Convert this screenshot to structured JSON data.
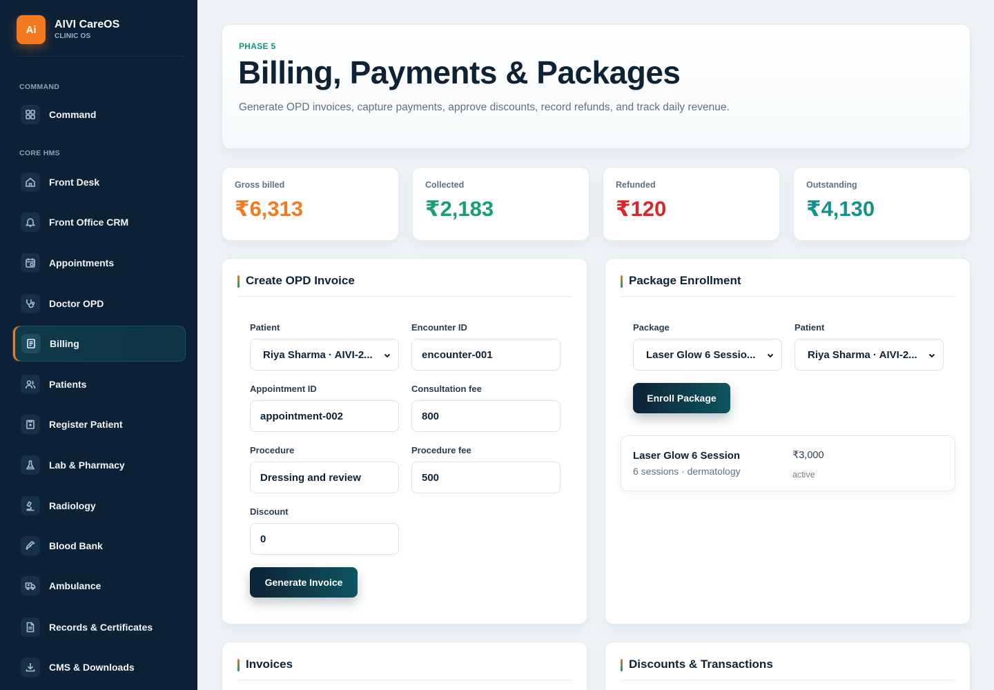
{
  "brand": {
    "logo": "Ai",
    "name": "AIVI CareOS",
    "sub": "CLINIC OS"
  },
  "sidebar": {
    "sections": [
      {
        "label": "COMMAND"
      },
      {
        "label": "CORE HMS"
      }
    ],
    "items": [
      {
        "label": "Command",
        "icon": "grid-icon"
      },
      {
        "label": "Front Desk",
        "icon": "home-icon"
      },
      {
        "label": "Front Office CRM",
        "icon": "bell-icon"
      },
      {
        "label": "Appointments",
        "icon": "calendar-icon"
      },
      {
        "label": "Doctor OPD",
        "icon": "stethoscope-icon"
      },
      {
        "label": "Billing",
        "icon": "receipt-icon",
        "active": true
      },
      {
        "label": "Patients",
        "icon": "users-icon"
      },
      {
        "label": "Register Patient",
        "icon": "clipboard-icon"
      },
      {
        "label": "Lab & Pharmacy",
        "icon": "flask-icon"
      },
      {
        "label": "Radiology",
        "icon": "microscope-icon"
      },
      {
        "label": "Blood Bank",
        "icon": "syringe-icon"
      },
      {
        "label": "Ambulance",
        "icon": "ambulance-icon"
      },
      {
        "label": "Records & Certificates",
        "icon": "document-icon"
      },
      {
        "label": "CMS & Downloads",
        "icon": "download-icon"
      }
    ]
  },
  "hero": {
    "phase": "PHASE 5",
    "title": "Billing, Payments & Packages",
    "description": "Generate OPD invoices, capture payments, approve discounts, record refunds, and track daily revenue."
  },
  "stats": [
    {
      "label": "Gross billed",
      "value": "₹6,313",
      "color": "#f47a1f"
    },
    {
      "label": "Collected",
      "value": "₹2,183",
      "color": "#16a072"
    },
    {
      "label": "Refunded",
      "value": "₹120",
      "color": "#d8262b"
    },
    {
      "label": "Outstanding",
      "value": "₹4,130",
      "color": "#12938a"
    }
  ],
  "invoice_form": {
    "title": "Create OPD Invoice",
    "patient_label": "Patient",
    "patient_value": "Riya Sharma · AIVI-2...",
    "encounter_label": "Encounter ID",
    "encounter_value": "encounter-001",
    "appointment_label": "Appointment ID",
    "appointment_value": "appointment-002",
    "consult_label": "Consultation fee",
    "consult_value": "800",
    "procedure_label": "Procedure",
    "procedure_value": "Dressing and review",
    "procedure_fee_label": "Procedure fee",
    "procedure_fee_value": "500",
    "discount_label": "Discount",
    "discount_value": "0",
    "submit_label": "Generate Invoice"
  },
  "package_form": {
    "title": "Package Enrollment",
    "package_label": "Package",
    "package_value": "Laser Glow 6 Sessio...",
    "patient_label": "Patient",
    "patient_value": "Riya Sharma · AIVI-2...",
    "submit_label": "Enroll Package",
    "packages": [
      {
        "name": "Laser Glow 6 Session",
        "meta": "6 sessions · dermatology",
        "price": "₹3,000",
        "status": "active"
      }
    ]
  },
  "invoices_panel": {
    "title": "Invoices"
  },
  "transactions_panel": {
    "title": "Discounts & Transactions"
  }
}
